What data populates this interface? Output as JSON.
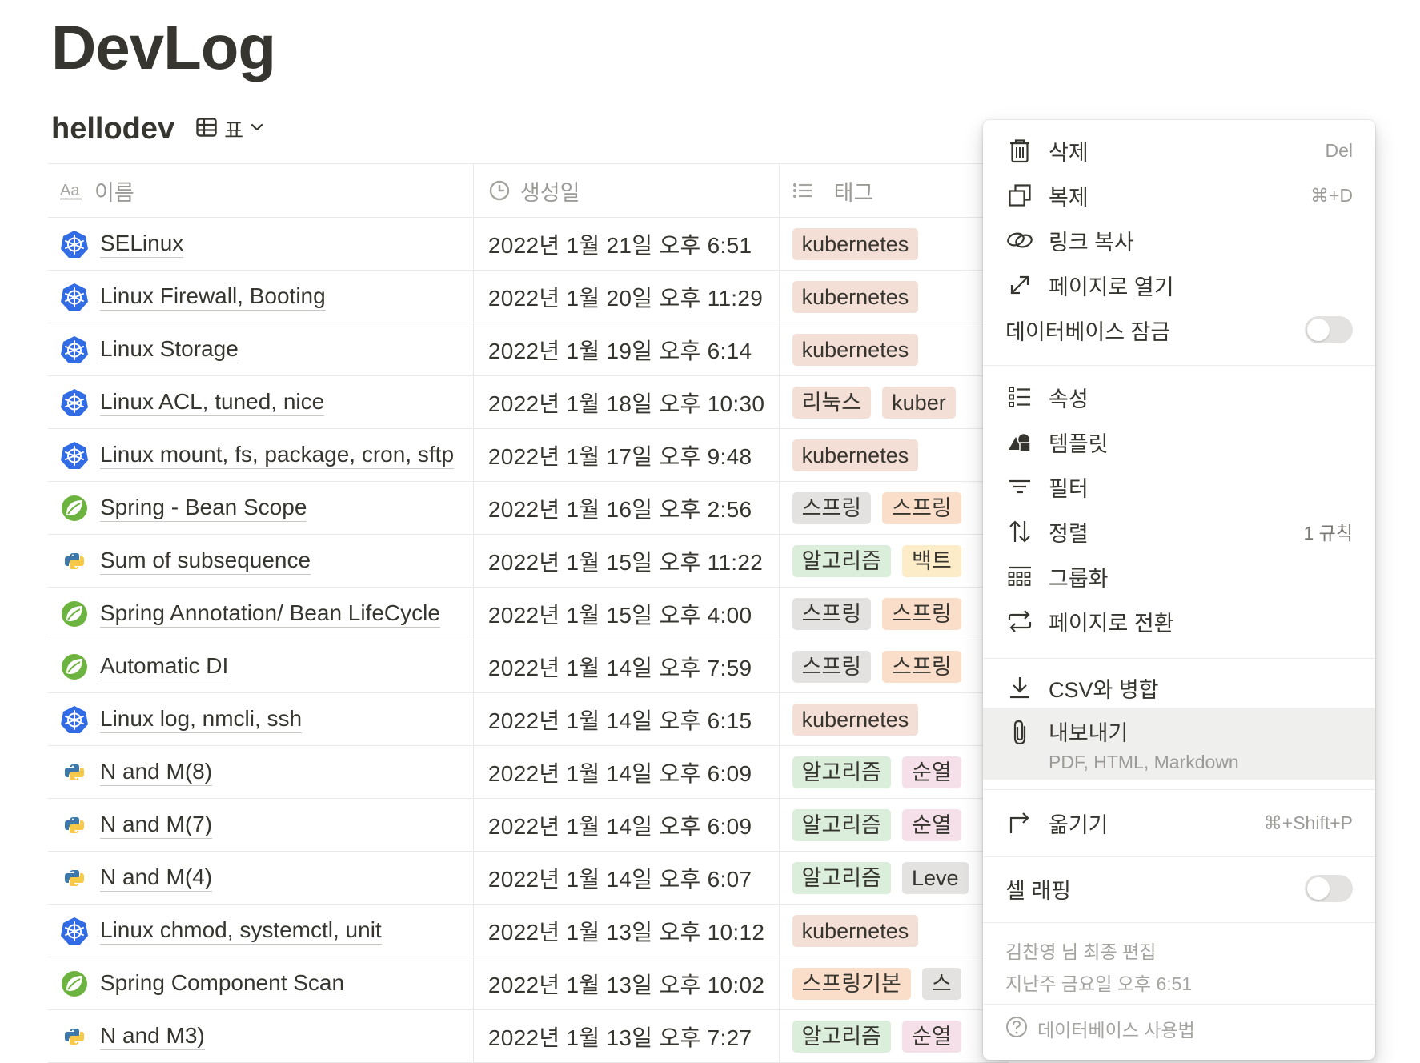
{
  "page": {
    "title": "DevLog"
  },
  "database": {
    "name": "hellodev",
    "view_label": "표"
  },
  "table": {
    "columns": [
      {
        "icon": "text-property-icon",
        "label": "이름"
      },
      {
        "icon": "clock-icon",
        "label": "생성일"
      },
      {
        "icon": "list-property-icon",
        "label": "태그"
      }
    ],
    "rows": [
      {
        "icon": "kubernetes-icon",
        "title": "SELinux",
        "date": "2022년 1월 21일 오후 6:51",
        "tags": [
          {
            "text": "kubernetes",
            "color": "#f4dfd6"
          }
        ]
      },
      {
        "icon": "kubernetes-icon",
        "title": "Linux Firewall, Booting",
        "date": "2022년 1월 20일 오후 11:29",
        "tags": [
          {
            "text": "kubernetes",
            "color": "#f4dfd6"
          }
        ]
      },
      {
        "icon": "kubernetes-icon",
        "title": "Linux Storage",
        "date": "2022년 1월 19일 오후 6:14",
        "tags": [
          {
            "text": "kubernetes",
            "color": "#f4dfd6"
          }
        ]
      },
      {
        "icon": "kubernetes-icon",
        "title": "Linux ACL, tuned, nice",
        "date": "2022년 1월 18일 오후 10:30",
        "tags": [
          {
            "text": "리눅스",
            "color": "#f4dfd6"
          },
          {
            "text": "kuber",
            "color": "#f4dfd6"
          }
        ]
      },
      {
        "icon": "kubernetes-icon",
        "title": "Linux mount, fs, package, cron, sftp",
        "date": "2022년 1월 17일 오후 9:48",
        "tags": [
          {
            "text": "kubernetes",
            "color": "#f4dfd6"
          }
        ]
      },
      {
        "icon": "spring-icon",
        "title": "Spring - Bean Scope",
        "date": "2022년 1월 16일 오후 2:56",
        "tags": [
          {
            "text": "스프링",
            "color": "#e3e2e0"
          },
          {
            "text": "스프링",
            "color": "#fadec9"
          }
        ]
      },
      {
        "icon": "python-icon",
        "title": "Sum of subsequence",
        "date": "2022년 1월 15일 오후 11:22",
        "tags": [
          {
            "text": "알고리즘",
            "color": "#dbeddb"
          },
          {
            "text": "백트",
            "color": "#fdecc8"
          }
        ]
      },
      {
        "icon": "spring-icon",
        "title": "Spring Annotation/ Bean LifeCycle",
        "date": "2022년 1월 15일 오후 4:00",
        "tags": [
          {
            "text": "스프링",
            "color": "#e3e2e0"
          },
          {
            "text": "스프링",
            "color": "#fadec9"
          }
        ]
      },
      {
        "icon": "spring-icon",
        "title": "Automatic DI",
        "date": "2022년 1월 14일 오후 7:59",
        "tags": [
          {
            "text": "스프링",
            "color": "#e3e2e0"
          },
          {
            "text": "스프링",
            "color": "#fadec9"
          }
        ]
      },
      {
        "icon": "kubernetes-icon",
        "title": "Linux log, nmcli, ssh",
        "date": "2022년 1월 14일 오후 6:15",
        "tags": [
          {
            "text": "kubernetes",
            "color": "#f4dfd6"
          }
        ]
      },
      {
        "icon": "python-icon",
        "title": "N and M(8)",
        "date": "2022년 1월 14일 오후 6:09",
        "tags": [
          {
            "text": "알고리즘",
            "color": "#dbeddb"
          },
          {
            "text": "순열",
            "color": "#f5e0e9"
          }
        ]
      },
      {
        "icon": "python-icon",
        "title": "N and M(7)",
        "date": "2022년 1월 14일 오후 6:09",
        "tags": [
          {
            "text": "알고리즘",
            "color": "#dbeddb"
          },
          {
            "text": "순열",
            "color": "#f5e0e9"
          }
        ]
      },
      {
        "icon": "python-icon",
        "title": "N and M(4)",
        "date": "2022년 1월 14일 오후 6:07",
        "tags": [
          {
            "text": "알고리즘",
            "color": "#dbeddb"
          },
          {
            "text": "Leve",
            "color": "#e3e2e0"
          }
        ]
      },
      {
        "icon": "kubernetes-icon",
        "title": "Linux chmod, systemctl, unit",
        "date": "2022년 1월 13일 오후 10:12",
        "tags": [
          {
            "text": "kubernetes",
            "color": "#f4dfd6"
          }
        ]
      },
      {
        "icon": "spring-icon",
        "title": "Spring Component Scan",
        "date": "2022년 1월 13일 오후 10:02",
        "tags": [
          {
            "text": "스프링기본",
            "color": "#fadec9"
          },
          {
            "text": "스",
            "color": "#e3e2e0"
          }
        ]
      },
      {
        "icon": "python-icon",
        "title": "N and M3)",
        "date": "2022년 1월 13일 오후 7:27",
        "tags": [
          {
            "text": "알고리즘",
            "color": "#dbeddb"
          },
          {
            "text": "순열",
            "color": "#f5e0e9"
          }
        ]
      }
    ]
  },
  "menu": {
    "delete": {
      "label": "삭제",
      "shortcut": "Del"
    },
    "duplicate": {
      "label": "복제",
      "shortcut": "⌘+D"
    },
    "copy_link": {
      "label": "링크 복사"
    },
    "open_as_page": {
      "label": "페이지로 열기"
    },
    "lock_database": {
      "label": "데이터베이스 잠금",
      "on": false
    },
    "properties": {
      "label": "속성"
    },
    "templates": {
      "label": "템플릿"
    },
    "filter": {
      "label": "필터"
    },
    "sort": {
      "label": "정렬",
      "value": "1 규칙"
    },
    "group": {
      "label": "그룹화"
    },
    "turn_into_page": {
      "label": "페이지로 전환"
    },
    "merge_csv": {
      "label": "CSV와 병합"
    },
    "export": {
      "label": "내보내기",
      "sub": "PDF, HTML, Markdown"
    },
    "move_to": {
      "label": "옮기기",
      "shortcut": "⌘+Shift+P"
    },
    "wrap_cells": {
      "label": "셀 래핑",
      "on": false
    },
    "last_edited_by": "김찬영 님 최종 편집",
    "last_edited_time": "지난주 금요일 오후 6:51",
    "help": {
      "label": "데이터베이스 사용법"
    }
  }
}
